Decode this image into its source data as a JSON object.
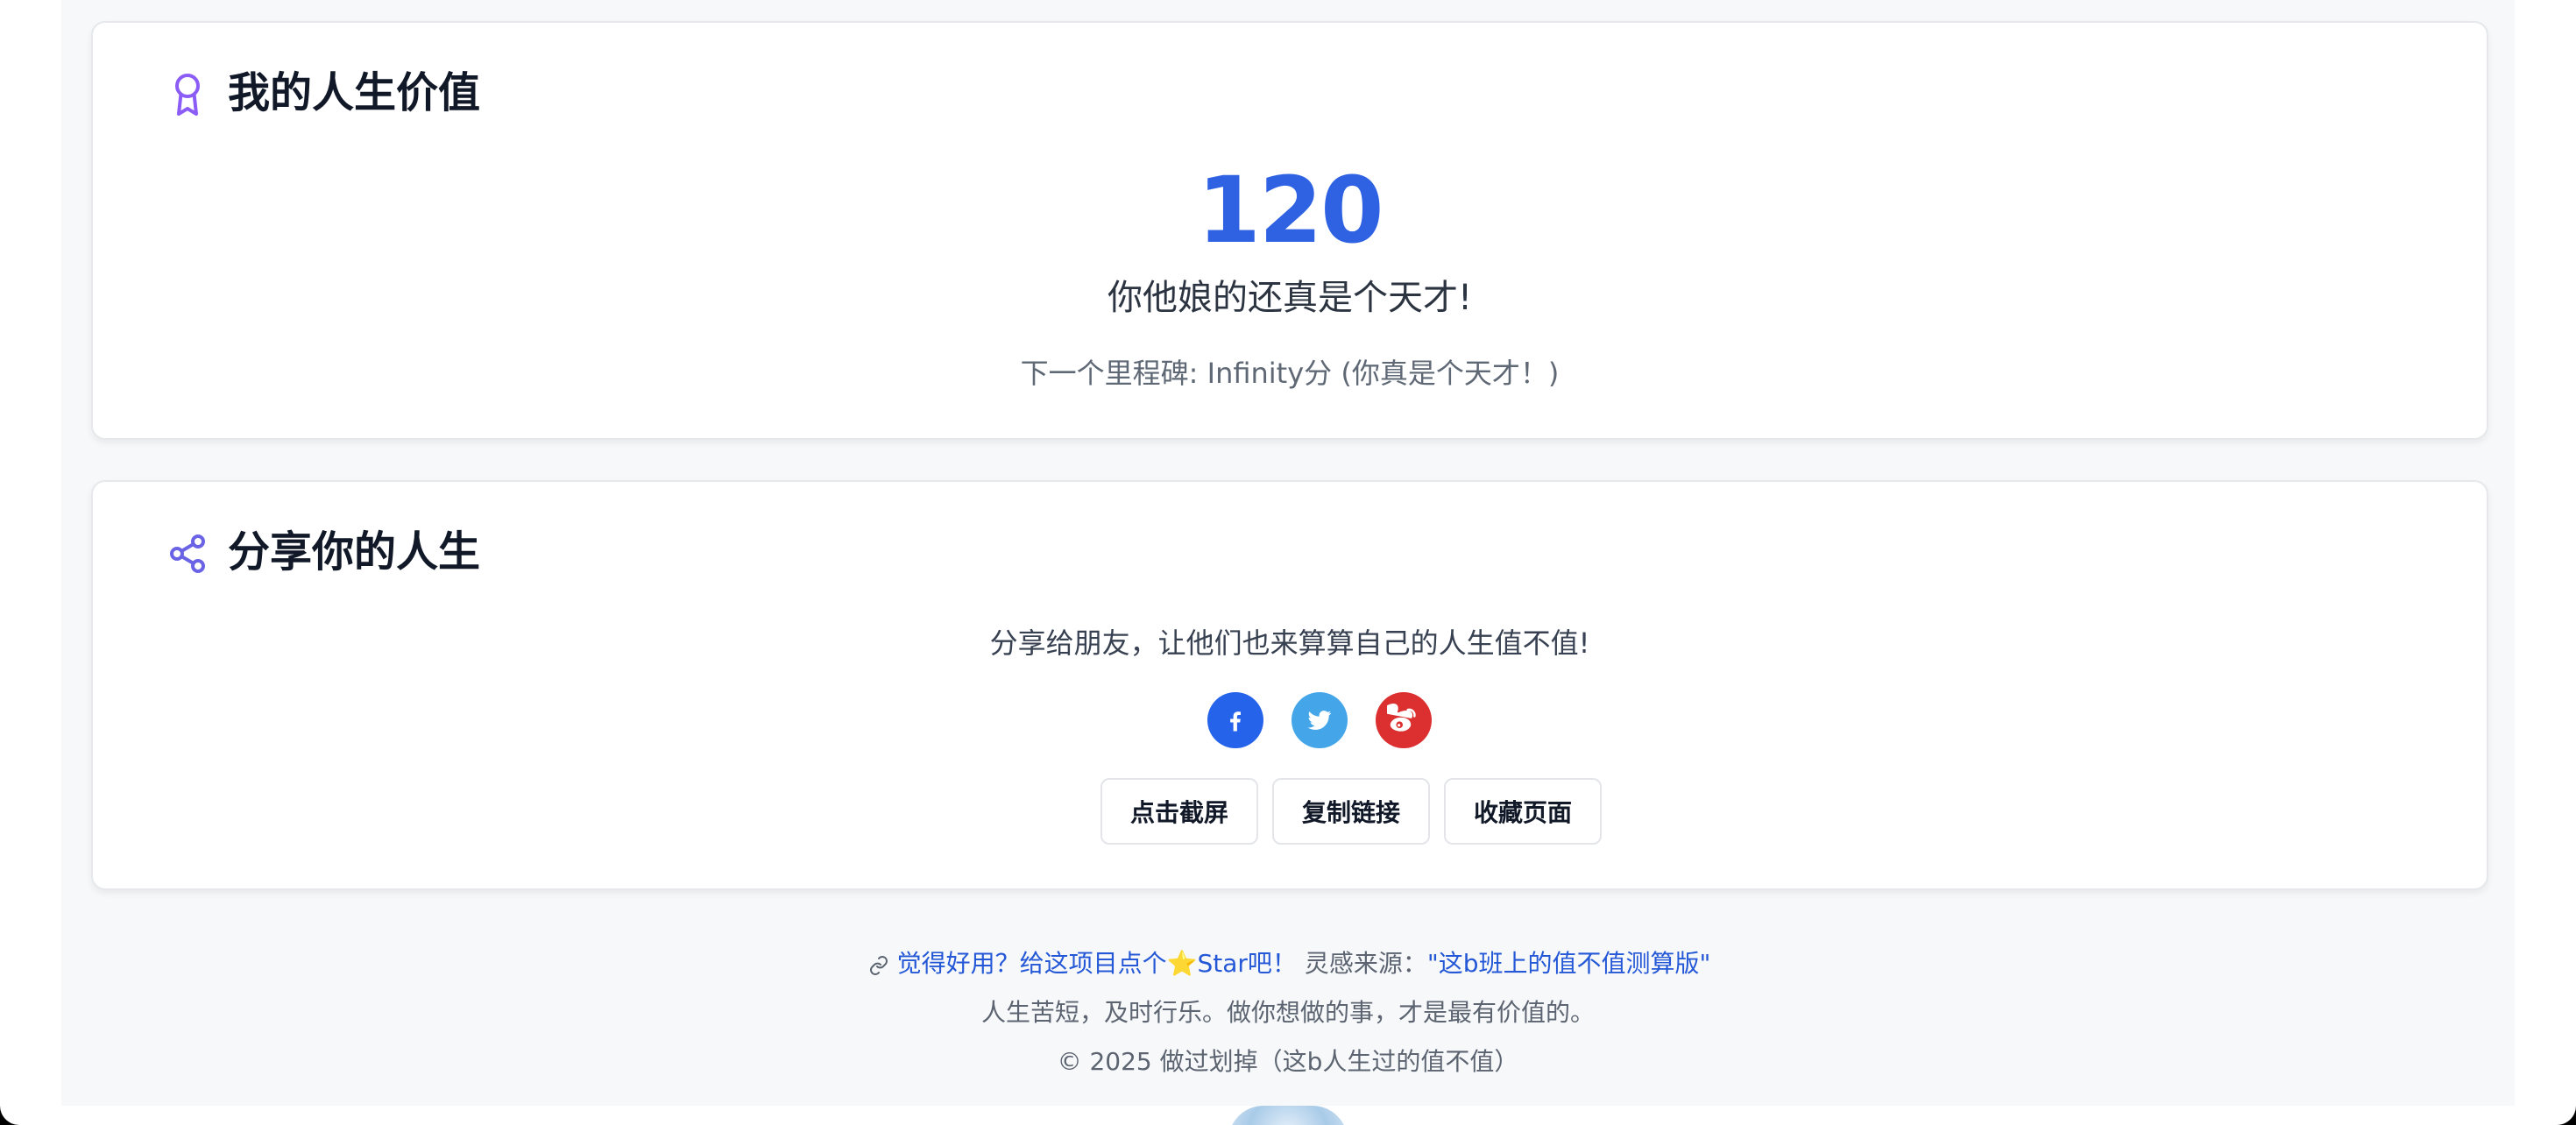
{
  "value_card": {
    "title": "我的人生价值",
    "score": "120",
    "verdict": "你他娘的还真是个天才!",
    "milestone": "下一个里程碑: Infinity分 (你真是个天才！)"
  },
  "share_card": {
    "title": "分享你的人生",
    "description": "分享给朋友，让他们也来算算自己的人生值不值!",
    "social": [
      {
        "name": "facebook-icon",
        "glyph": "f",
        "color": "#2563eb"
      },
      {
        "name": "twitter-icon",
        "glyph": "bird",
        "color": "#44a6e9"
      },
      {
        "name": "weibo-icon",
        "glyph": "weibo",
        "color": "#dc2f2f"
      }
    ],
    "buttons": {
      "screenshot": "点击截屏",
      "copy_link": "复制链接",
      "bookmark": "收藏页面"
    }
  },
  "footer": {
    "star_prompt": "觉得好用？给这项目点个",
    "star_suffix": "Star吧！",
    "inspiration_label": "灵感来源：",
    "inspiration_link": "\"这b班上的值不值测算版\"",
    "motto": "人生苦短，及时行乐。做你想做的事，才是最有价值的。",
    "copyright": "© 2025 做过划掉（这b人生过的值不值）"
  },
  "colors": {
    "accent": "#2f62e3",
    "icon_purple": "#8b5cf6"
  }
}
